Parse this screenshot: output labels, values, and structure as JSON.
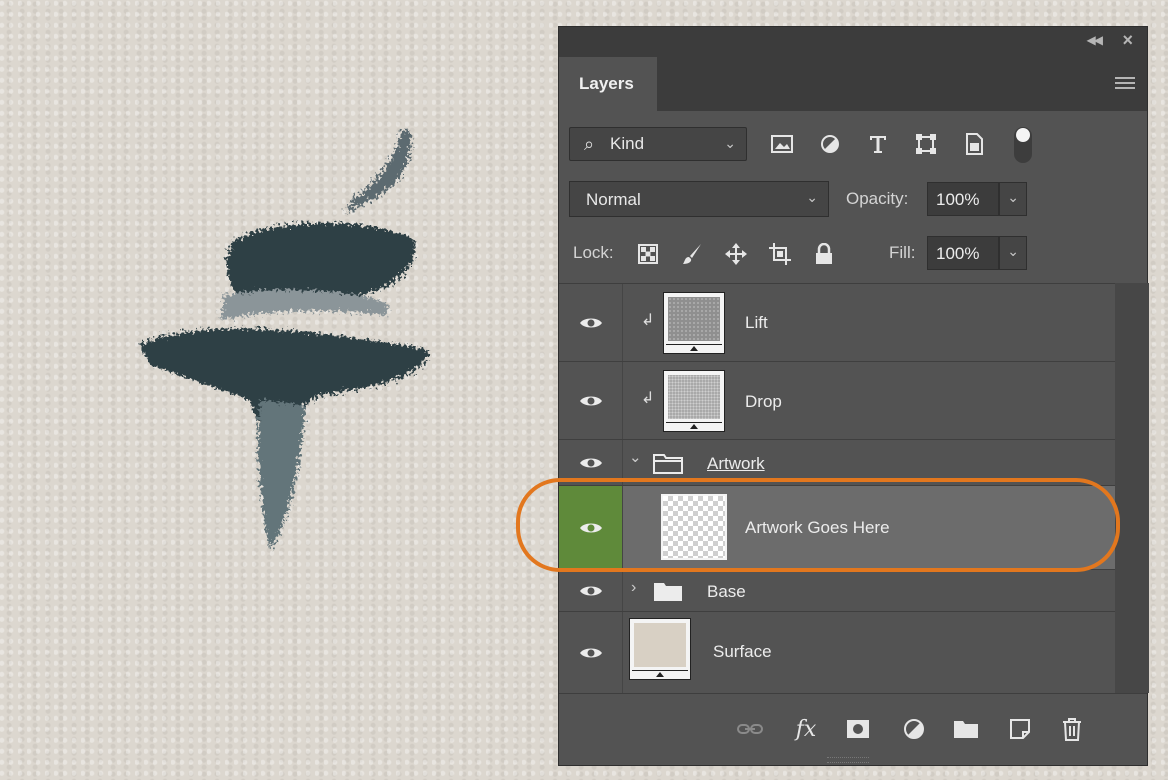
{
  "panel": {
    "tab_label": "Layers",
    "filter": {
      "kind_label": "Kind"
    },
    "blend_mode": "Normal",
    "opacity_label": "Opacity:",
    "opacity_value": "100%",
    "lock_label": "Lock:",
    "fill_label": "Fill:",
    "fill_value": "100%"
  },
  "layers": [
    {
      "name": "Lift",
      "clipped": true,
      "visible": true
    },
    {
      "name": "Drop",
      "clipped": true,
      "visible": true
    },
    {
      "name": "Artwork",
      "type": "group",
      "expanded": true,
      "visible": true
    },
    {
      "name": "Artwork Goes Here",
      "selected": true,
      "visible": true
    },
    {
      "name": "Base",
      "type": "group",
      "expanded": false,
      "visible": true
    },
    {
      "name": "Surface",
      "visible": true
    }
  ],
  "colors": {
    "panel_bg": "#535353",
    "selected_eye": "#5f8a3a",
    "highlight_ring": "#e2771e",
    "brush_stroke": "#2f3f44"
  }
}
